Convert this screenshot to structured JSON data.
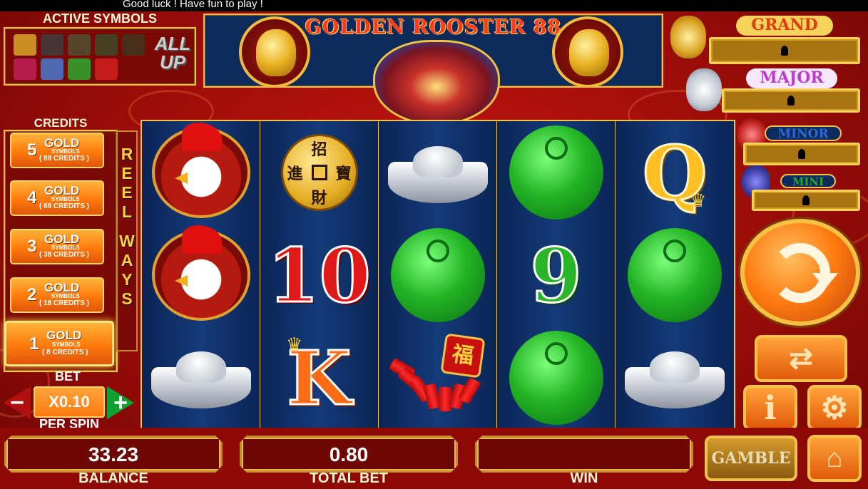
{
  "status_message": "Good luck ! Have fun to play !",
  "active_symbols": {
    "title": "ACTIVE SYMBOLS",
    "all_up_label": "ALL UP",
    "symbol_colors": [
      "#d8a428",
      "#3d3d3d",
      "#505030",
      "#3b4a26",
      "#403520",
      "#c0205a",
      "#4a7ad0",
      "#2fa82f",
      "#d02020"
    ]
  },
  "game": {
    "title": "GOLDEN ROOSTER 88"
  },
  "jackpots": [
    {
      "name": "GRAND",
      "color": "#e03a10",
      "bg": "#f7d35c"
    },
    {
      "name": "MAJOR",
      "color": "#c03ad0",
      "bg": "#f7e8ff"
    },
    {
      "name": "MINOR",
      "color": "#2a6ad8",
      "bg": "#0d2a5c"
    },
    {
      "name": "MINI",
      "color": "#28a828",
      "bg": "#0d2a5c"
    }
  ],
  "credits": {
    "title": "CREDITS",
    "options": [
      {
        "count": "5",
        "gold": "GOLD",
        "symbols": "SYMBOLS",
        "credits": "( 88 CREDITS )",
        "active": false
      },
      {
        "count": "4",
        "gold": "GOLD",
        "symbols": "SYMBOLS",
        "credits": "( 68 CREDITS )",
        "active": false
      },
      {
        "count": "3",
        "gold": "GOLD",
        "symbols": "SYMBOLS",
        "credits": "( 38 CREDITS )",
        "active": false
      },
      {
        "count": "2",
        "gold": "GOLD",
        "symbols": "SYMBOLS",
        "credits": "( 18 CREDITS )",
        "active": false
      },
      {
        "count": "1",
        "gold": "GOLD",
        "symbols": "SYMBOLS",
        "credits": "( 8 CREDITS )",
        "active": true
      }
    ]
  },
  "reel_ways_label": "REEL WAYS",
  "bet": {
    "label": "BET",
    "value": "X0.10",
    "per_spin_label": "PER SPIN",
    "minus": "−",
    "plus": "+"
  },
  "reels": [
    [
      "rooster",
      "rooster",
      "silver-ingot"
    ],
    [
      "gold-coin",
      "ten",
      "king"
    ],
    [
      "silver-ingot",
      "jade",
      "firecracker"
    ],
    [
      "jade",
      "nine",
      "jade"
    ],
    [
      "queen",
      "jade",
      "silver-ingot"
    ]
  ],
  "symbols": {
    "ten": "10",
    "nine": "9",
    "queen": "Q",
    "king": "K",
    "coin_chars": [
      "招",
      "寶",
      "進",
      "財"
    ],
    "fu_char": "福"
  },
  "buttons": {
    "gamble": "GAMBLE",
    "info": "i",
    "settings_icon": "⚙",
    "home_icon": "⌂",
    "autoplay_icon": "⇄"
  },
  "bottom": {
    "balance_label": "BALANCE",
    "balance_value": "33.23",
    "total_bet_label": "TOTAL BET",
    "total_bet_value": "0.80",
    "win_label": "WIN",
    "win_value": ""
  }
}
